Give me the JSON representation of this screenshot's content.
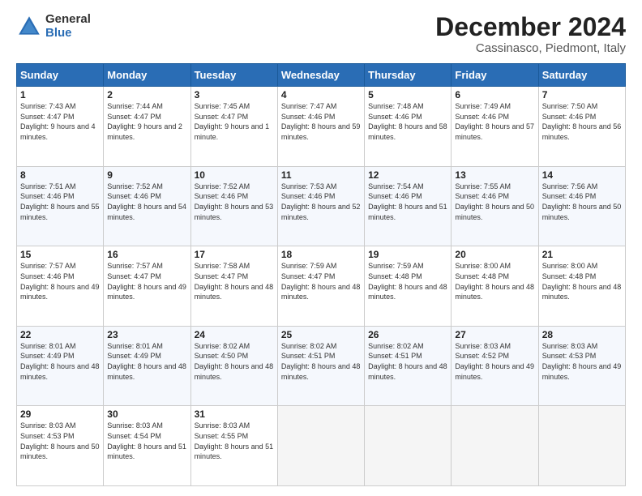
{
  "logo": {
    "general": "General",
    "blue": "Blue"
  },
  "header": {
    "title": "December 2024",
    "subtitle": "Cassinasco, Piedmont, Italy"
  },
  "days_of_week": [
    "Sunday",
    "Monday",
    "Tuesday",
    "Wednesday",
    "Thursday",
    "Friday",
    "Saturday"
  ],
  "weeks": [
    [
      {
        "day": 1,
        "sunrise": "7:43 AM",
        "sunset": "4:47 PM",
        "daylight": "9 hours and 4 minutes."
      },
      {
        "day": 2,
        "sunrise": "7:44 AM",
        "sunset": "4:47 PM",
        "daylight": "9 hours and 2 minutes."
      },
      {
        "day": 3,
        "sunrise": "7:45 AM",
        "sunset": "4:47 PM",
        "daylight": "9 hours and 1 minute."
      },
      {
        "day": 4,
        "sunrise": "7:47 AM",
        "sunset": "4:46 PM",
        "daylight": "8 hours and 59 minutes."
      },
      {
        "day": 5,
        "sunrise": "7:48 AM",
        "sunset": "4:46 PM",
        "daylight": "8 hours and 58 minutes."
      },
      {
        "day": 6,
        "sunrise": "7:49 AM",
        "sunset": "4:46 PM",
        "daylight": "8 hours and 57 minutes."
      },
      {
        "day": 7,
        "sunrise": "7:50 AM",
        "sunset": "4:46 PM",
        "daylight": "8 hours and 56 minutes."
      }
    ],
    [
      {
        "day": 8,
        "sunrise": "7:51 AM",
        "sunset": "4:46 PM",
        "daylight": "8 hours and 55 minutes."
      },
      {
        "day": 9,
        "sunrise": "7:52 AM",
        "sunset": "4:46 PM",
        "daylight": "8 hours and 54 minutes."
      },
      {
        "day": 10,
        "sunrise": "7:52 AM",
        "sunset": "4:46 PM",
        "daylight": "8 hours and 53 minutes."
      },
      {
        "day": 11,
        "sunrise": "7:53 AM",
        "sunset": "4:46 PM",
        "daylight": "8 hours and 52 minutes."
      },
      {
        "day": 12,
        "sunrise": "7:54 AM",
        "sunset": "4:46 PM",
        "daylight": "8 hours and 51 minutes."
      },
      {
        "day": 13,
        "sunrise": "7:55 AM",
        "sunset": "4:46 PM",
        "daylight": "8 hours and 50 minutes."
      },
      {
        "day": 14,
        "sunrise": "7:56 AM",
        "sunset": "4:46 PM",
        "daylight": "8 hours and 50 minutes."
      }
    ],
    [
      {
        "day": 15,
        "sunrise": "7:57 AM",
        "sunset": "4:46 PM",
        "daylight": "8 hours and 49 minutes."
      },
      {
        "day": 16,
        "sunrise": "7:57 AM",
        "sunset": "4:47 PM",
        "daylight": "8 hours and 49 minutes."
      },
      {
        "day": 17,
        "sunrise": "7:58 AM",
        "sunset": "4:47 PM",
        "daylight": "8 hours and 48 minutes."
      },
      {
        "day": 18,
        "sunrise": "7:59 AM",
        "sunset": "4:47 PM",
        "daylight": "8 hours and 48 minutes."
      },
      {
        "day": 19,
        "sunrise": "7:59 AM",
        "sunset": "4:48 PM",
        "daylight": "8 hours and 48 minutes."
      },
      {
        "day": 20,
        "sunrise": "8:00 AM",
        "sunset": "4:48 PM",
        "daylight": "8 hours and 48 minutes."
      },
      {
        "day": 21,
        "sunrise": "8:00 AM",
        "sunset": "4:48 PM",
        "daylight": "8 hours and 48 minutes."
      }
    ],
    [
      {
        "day": 22,
        "sunrise": "8:01 AM",
        "sunset": "4:49 PM",
        "daylight": "8 hours and 48 minutes."
      },
      {
        "day": 23,
        "sunrise": "8:01 AM",
        "sunset": "4:49 PM",
        "daylight": "8 hours and 48 minutes."
      },
      {
        "day": 24,
        "sunrise": "8:02 AM",
        "sunset": "4:50 PM",
        "daylight": "8 hours and 48 minutes."
      },
      {
        "day": 25,
        "sunrise": "8:02 AM",
        "sunset": "4:51 PM",
        "daylight": "8 hours and 48 minutes."
      },
      {
        "day": 26,
        "sunrise": "8:02 AM",
        "sunset": "4:51 PM",
        "daylight": "8 hours and 48 minutes."
      },
      {
        "day": 27,
        "sunrise": "8:03 AM",
        "sunset": "4:52 PM",
        "daylight": "8 hours and 49 minutes."
      },
      {
        "day": 28,
        "sunrise": "8:03 AM",
        "sunset": "4:53 PM",
        "daylight": "8 hours and 49 minutes."
      }
    ],
    [
      {
        "day": 29,
        "sunrise": "8:03 AM",
        "sunset": "4:53 PM",
        "daylight": "8 hours and 50 minutes."
      },
      {
        "day": 30,
        "sunrise": "8:03 AM",
        "sunset": "4:54 PM",
        "daylight": "8 hours and 51 minutes."
      },
      {
        "day": 31,
        "sunrise": "8:03 AM",
        "sunset": "4:55 PM",
        "daylight": "8 hours and 51 minutes."
      },
      null,
      null,
      null,
      null
    ]
  ]
}
